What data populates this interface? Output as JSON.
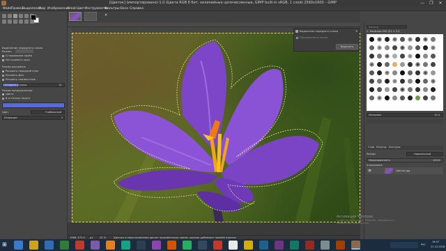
{
  "window": {
    "title": "[Цветок] (импортировано)-1.0 (Цвета RGB 8 бит, нелинейные целочисленные, GIMP built-in sRGB, 1 слой) 2560x1600 – GIMP",
    "controls": [
      "—",
      "❐",
      "✕"
    ]
  },
  "menu": [
    "Файл",
    "Правка",
    "Выделение",
    "Вид",
    "Изображение",
    "Слой",
    "Цвет",
    "Инструменты",
    "Фильтры",
    "Окна",
    "Справка"
  ],
  "toolbox": {
    "options_title": "Выделение переднего плана",
    "mode_label": "Режим:",
    "antialias_label": "Сглаживание краёв",
    "rows": [
      "Растушевать края",
      "Режим рисования",
      "Рисовать передний план",
      "Рисовать фон",
      "Рисовать неизвестные"
    ],
    "threshold_label": "Толщина штриха",
    "threshold_value": "10",
    "preview_label": "Режим предпросмотра",
    "preview_options": [
      "Цвета",
      "В оттенках серого"
    ],
    "color_label": "Цвет",
    "engine_label": "Движок",
    "engine_value": "Глобальный",
    "iterations_label": "Итерации",
    "iterations_value": "2"
  },
  "dialog": {
    "title": "Выделение переднего плана",
    "preview_toggle": "Предпросмотр маски",
    "button": "Выделить"
  },
  "statusbar": {
    "coords": "1988, 475.0",
    "unit": "px",
    "zoom": "25 %",
    "message": "Щелчок и перетаскивание рисует произвольную линию, щелчок добавляет прямой отрезок"
  },
  "brushes": {
    "filter_placeholder": "Фильтр",
    "label": "2. Hardness 050 (51 × 51)",
    "spacing_label": "Интервал",
    "spacing_value": "10.0"
  },
  "layers": {
    "tabs": [
      "Слои",
      "Каналы",
      "Контуры"
    ],
    "mode_label": "Режим",
    "mode_value": "Нормальный",
    "opacity_label": "Непрозрачность",
    "opacity_value": "100.0",
    "lock_label": "Блокировка:",
    "layer_name": "Цветок.jpg"
  },
  "activation": {
    "title": "Активация Windows",
    "body": "Чтобы активировать Windows, перейдите в параметры компьютера."
  },
  "taskbar": {
    "lang": "РУС",
    "time": "16:47",
    "date": "21.12.2018"
  },
  "colors": {
    "accent": "#6f7ae0",
    "fg_color": "#000000",
    "bg_color": "#ffffff",
    "selection_outline": "#e0d060",
    "petal": "#8a52d4"
  }
}
